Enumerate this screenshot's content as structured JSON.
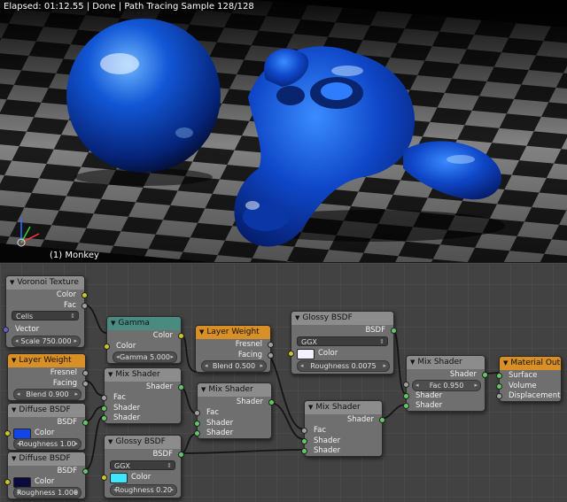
{
  "viewport": {
    "status_text": "Elapsed: 01:12.55 | Done | Path Tracing Sample 128/128",
    "object_label": "(1) Monkey"
  },
  "nodes": {
    "voronoi": {
      "title": "Voronoi Texture",
      "out_color": "Color",
      "out_fac": "Fac",
      "mode": "Cells",
      "in_vector": "Vector",
      "scale": "Scale 750.000"
    },
    "gamma": {
      "title": "Gamma",
      "out_color": "Color",
      "in_color": "Color",
      "gamma": "Gamma 5.000"
    },
    "layer_weight_1": {
      "title": "Layer Weight",
      "out_fresnel": "Fresnel",
      "out_facing": "Facing",
      "blend": "Blend 0.900"
    },
    "layer_weight_2": {
      "title": "Layer Weight",
      "out_fresnel": "Fresnel",
      "out_facing": "Facing",
      "blend": "Blend 0.500"
    },
    "glossy_1": {
      "title": "Glossy BSDF",
      "out_bsdf": "BSDF",
      "distribution": "GGX",
      "color_label": "Color",
      "color": "#f2f2ff",
      "roughness": "Roughness 0.0075"
    },
    "glossy_2": {
      "title": "Glossy BSDF",
      "out_bsdf": "BSDF",
      "distribution": "GGX",
      "color_label": "Color",
      "color": "#3ce8ff",
      "roughness": "Roughness 0.20"
    },
    "diffuse_1": {
      "title": "Diffuse BSDF",
      "out_bsdf": "BSDF",
      "color_label": "Color",
      "color": "#1245e6",
      "roughness": "Roughness 1.00"
    },
    "diffuse_2": {
      "title": "Diffuse BSDF",
      "out_bsdf": "BSDF",
      "color_label": "Color",
      "color": "#0a0a3c",
      "roughness": "Roughness 1.000"
    },
    "mix_1": {
      "title": "Mix Shader",
      "out_shader": "Shader",
      "in_fac": "Fac",
      "in_shader_a": "Shader",
      "in_shader_b": "Shader"
    },
    "mix_2": {
      "title": "Mix Shader",
      "out_shader": "Shader",
      "in_fac": "Fac",
      "in_shader_a": "Shader",
      "in_shader_b": "Shader"
    },
    "mix_3": {
      "title": "Mix Shader",
      "out_shader": "Shader",
      "in_fac": "Fac",
      "in_shader_a": "Shader",
      "in_shader_b": "Shader"
    },
    "mix_4": {
      "title": "Mix Shader",
      "out_shader": "Shader",
      "fac": "Fac 0.950",
      "in_shader_a": "Shader",
      "in_shader_b": "Shader"
    },
    "material_output": {
      "title": "Material Outpu",
      "in_surface": "Surface",
      "in_volume": "Volume",
      "in_displacement": "Displacement"
    }
  },
  "colors": {
    "socket_color": "#c7c729",
    "socket_shader": "#63c763",
    "socket_float": "#a1a1a1",
    "socket_vector": "#6363c7",
    "output_header": "#d88f26",
    "converter_header": "#4a8b80"
  }
}
